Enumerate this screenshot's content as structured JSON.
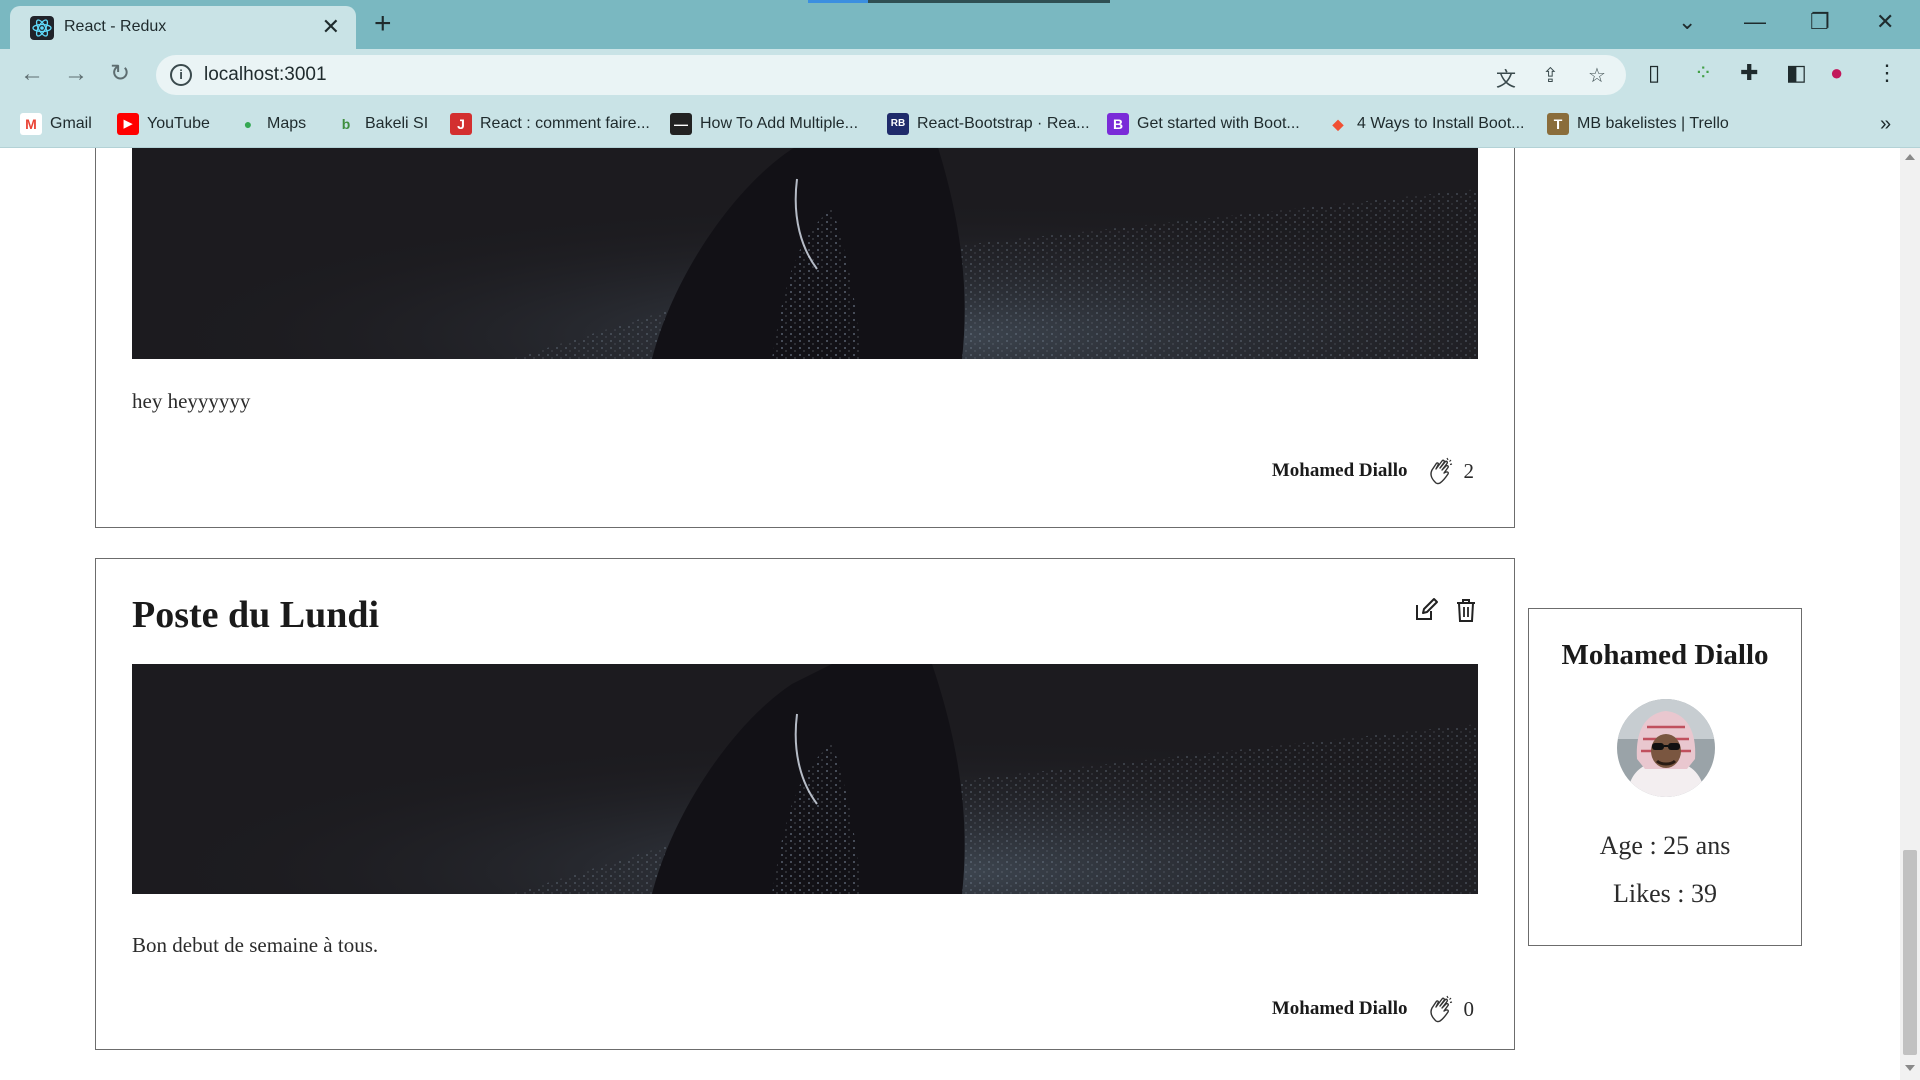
{
  "browser": {
    "tab_title": "React - Redux",
    "tab_close": "✕",
    "new_tab": "+",
    "url": "localhost:3001",
    "window_controls": {
      "tab_search": "⌄",
      "minimize": "—",
      "restore": "❐",
      "close": "✕"
    },
    "bookmarks": [
      {
        "label": "Gmail",
        "icon": "gmail-icon",
        "color": "#ea4335",
        "glyph": "M"
      },
      {
        "label": "YouTube",
        "icon": "youtube-icon",
        "color": "#ff0000",
        "glyph": "▶"
      },
      {
        "label": "Maps",
        "icon": "maps-icon",
        "color": "#34a853",
        "glyph": "●"
      },
      {
        "label": "Bakeli SI",
        "icon": "bakeli-icon",
        "color": "#3f8f3f",
        "glyph": "b"
      },
      {
        "label": "React : comment faire...",
        "icon": "journal-icon",
        "color": "#d32f2f",
        "glyph": "J"
      },
      {
        "label": "How To Add Multiple...",
        "icon": "page-icon",
        "color": "#222222",
        "glyph": "—"
      },
      {
        "label": "React-Bootstrap · Rea...",
        "icon": "react-bootstrap-icon",
        "color": "#1f2b6b",
        "glyph": "RB"
      },
      {
        "label": "Get started with Boot...",
        "icon": "bootstrap-icon",
        "color": "#7a2bd8",
        "glyph": "B"
      },
      {
        "label": "4 Ways to Install Boot...",
        "icon": "git-icon",
        "color": "#f05033",
        "glyph": "◆"
      },
      {
        "label": "MB bakelistes | Trello",
        "icon": "trello-icon",
        "color": "#8a6d3b",
        "glyph": "T"
      }
    ],
    "bookmarks_more": "»"
  },
  "posts": [
    {
      "title": "",
      "text": "hey heyyyyyy",
      "author": "Mohamed Diallo",
      "likes": "2"
    },
    {
      "title": "Poste du Lundi",
      "text": "Bon debut de semaine à tous.",
      "author": "Mohamed Diallo",
      "likes": "0"
    }
  ],
  "profile": {
    "name": "Mohamed Diallo",
    "age": "Age : 25 ans",
    "likes": "Likes : 39"
  },
  "colors": {
    "tabbar": "#7ab8c1",
    "toolbar": "#c9e3e6",
    "card_border": "#6c6c6c"
  }
}
